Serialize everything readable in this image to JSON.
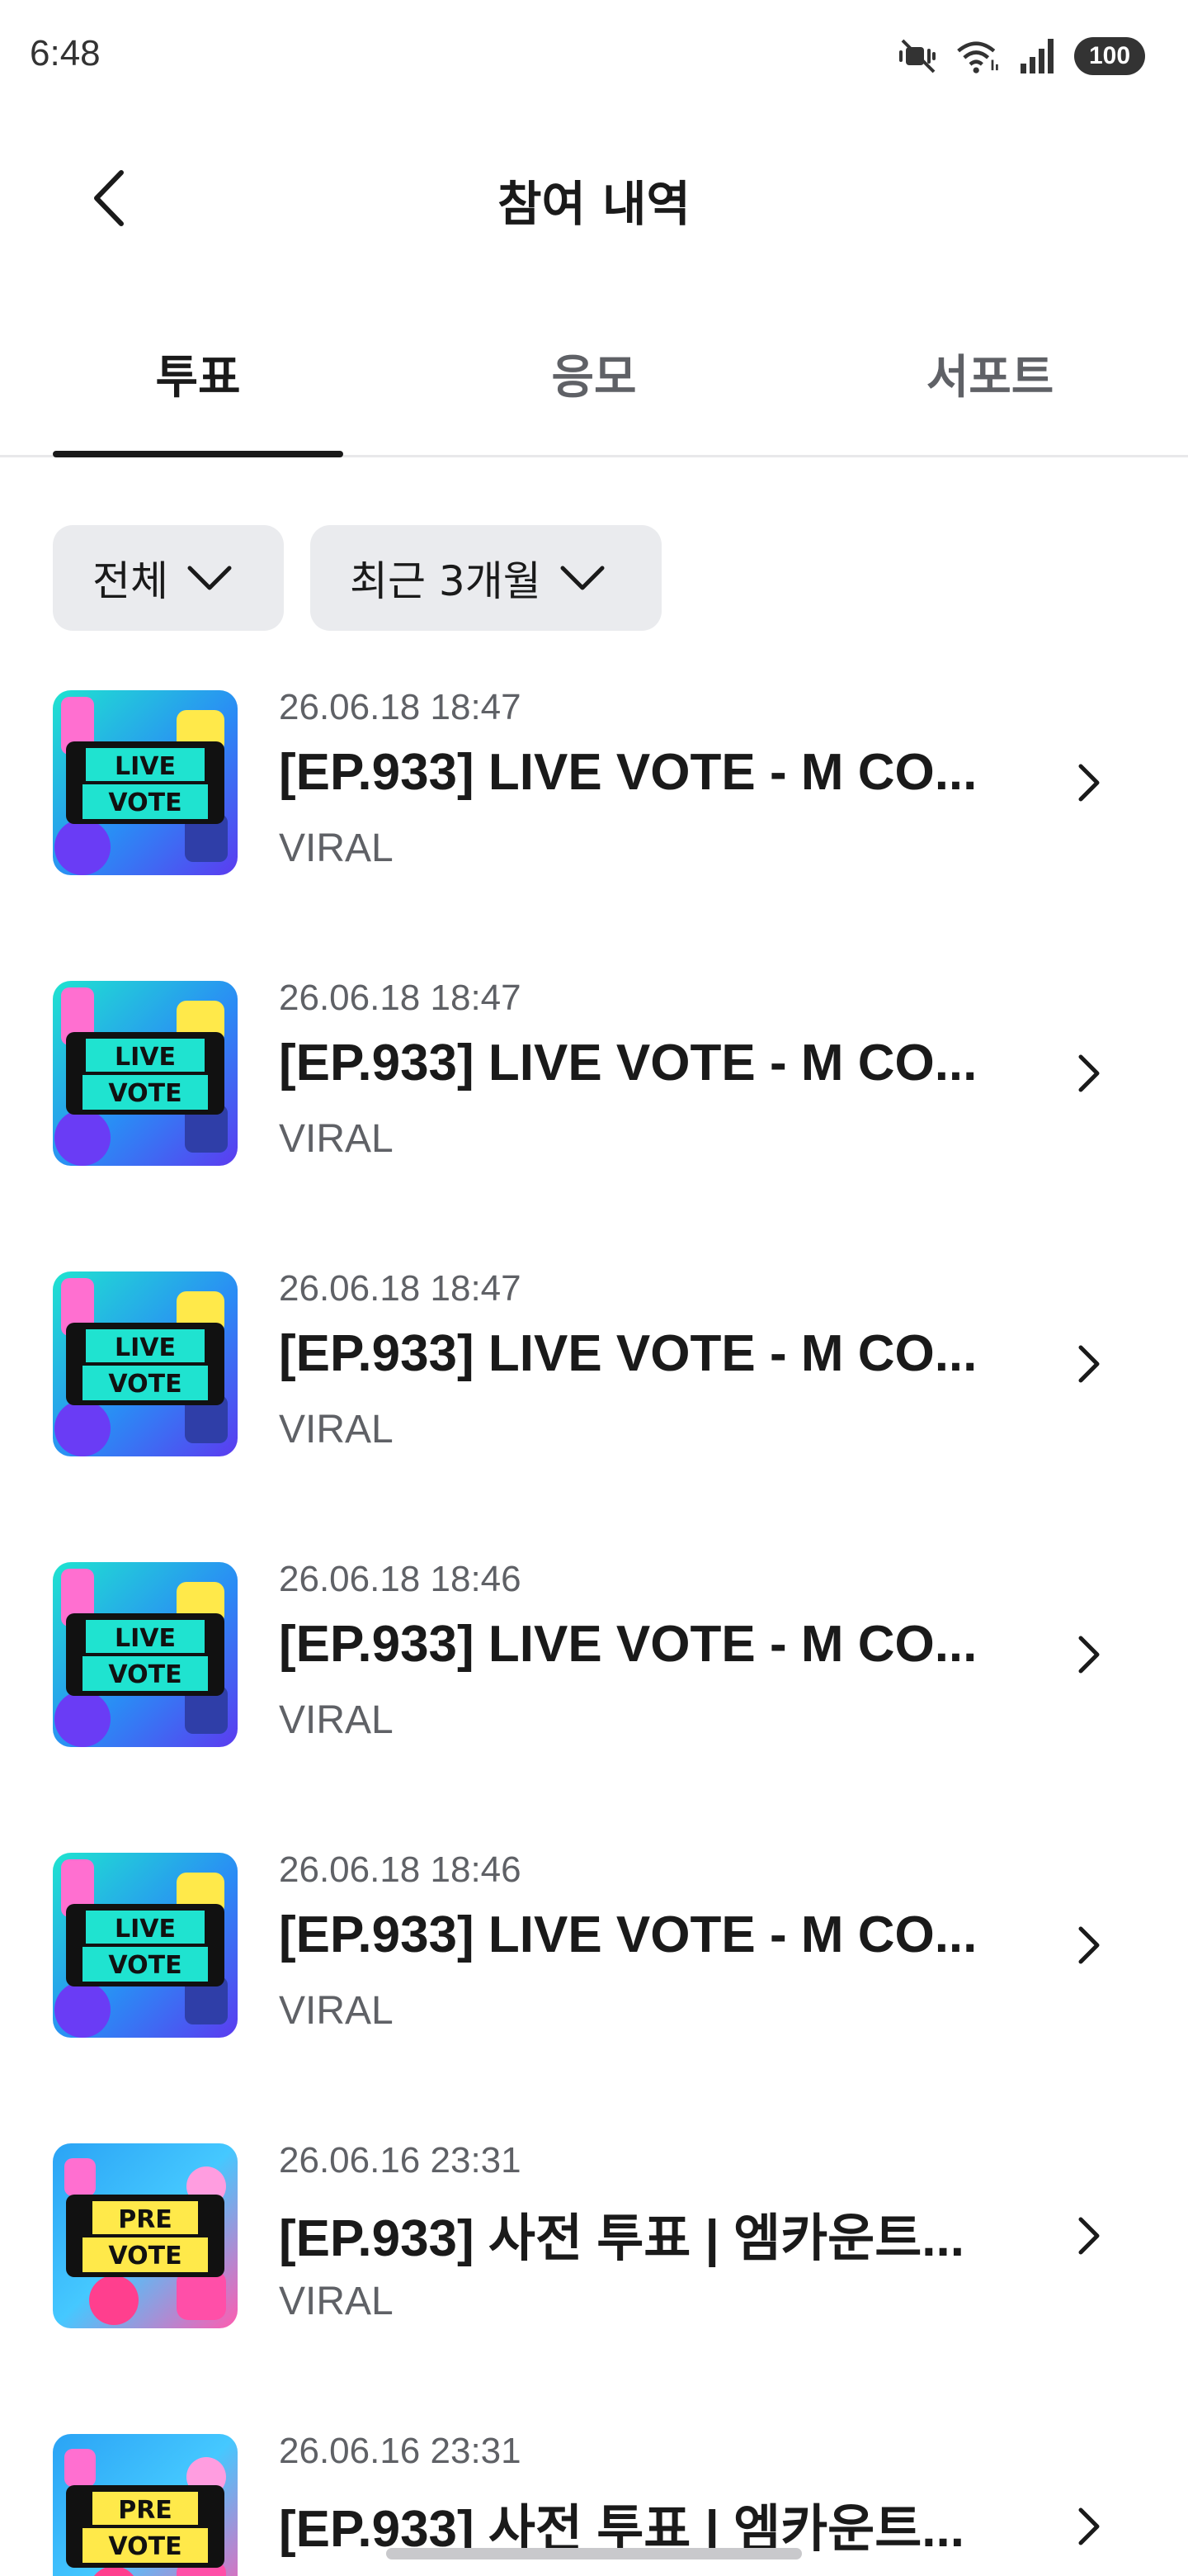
{
  "status_bar": {
    "time": "6:48",
    "battery": "100"
  },
  "header": {
    "title": "참여 내역"
  },
  "tabs": [
    {
      "label": "투표",
      "active": true
    },
    {
      "label": "응모",
      "active": false
    },
    {
      "label": "서포트",
      "active": false
    }
  ],
  "filters": [
    {
      "label": "전체"
    },
    {
      "label": "최근 3개월"
    }
  ],
  "items": [
    {
      "date": "26.06.18 18:47",
      "title": "[EP.933] LIVE VOTE - M CO...",
      "subtitle": "VIRAL",
      "thumb_line1": "LIVE",
      "thumb_line2": "VOTE"
    },
    {
      "date": "26.06.18 18:47",
      "title": "[EP.933] LIVE VOTE - M CO...",
      "subtitle": "VIRAL",
      "thumb_line1": "LIVE",
      "thumb_line2": "VOTE"
    },
    {
      "date": "26.06.18 18:47",
      "title": "[EP.933] LIVE VOTE - M CO...",
      "subtitle": "VIRAL",
      "thumb_line1": "LIVE",
      "thumb_line2": "VOTE"
    },
    {
      "date": "26.06.18 18:46",
      "title": "[EP.933] LIVE VOTE - M CO...",
      "subtitle": "VIRAL",
      "thumb_line1": "LIVE",
      "thumb_line2": "VOTE"
    },
    {
      "date": "26.06.18 18:46",
      "title": "[EP.933] LIVE VOTE - M CO...",
      "subtitle": "VIRAL",
      "thumb_line1": "LIVE",
      "thumb_line2": "VOTE"
    },
    {
      "date": "26.06.16 23:31",
      "title": "[EP.933] 사전 투표 | 엠카운트...",
      "subtitle": "VIRAL",
      "thumb_line1": "PRE",
      "thumb_line2": "VOTE"
    },
    {
      "date": "26.06.16 23:31",
      "title": "[EP.933] 사전 투표 | 엠카운트...",
      "subtitle": "",
      "thumb_line1": "PRE",
      "thumb_line2": "VOTE"
    }
  ]
}
